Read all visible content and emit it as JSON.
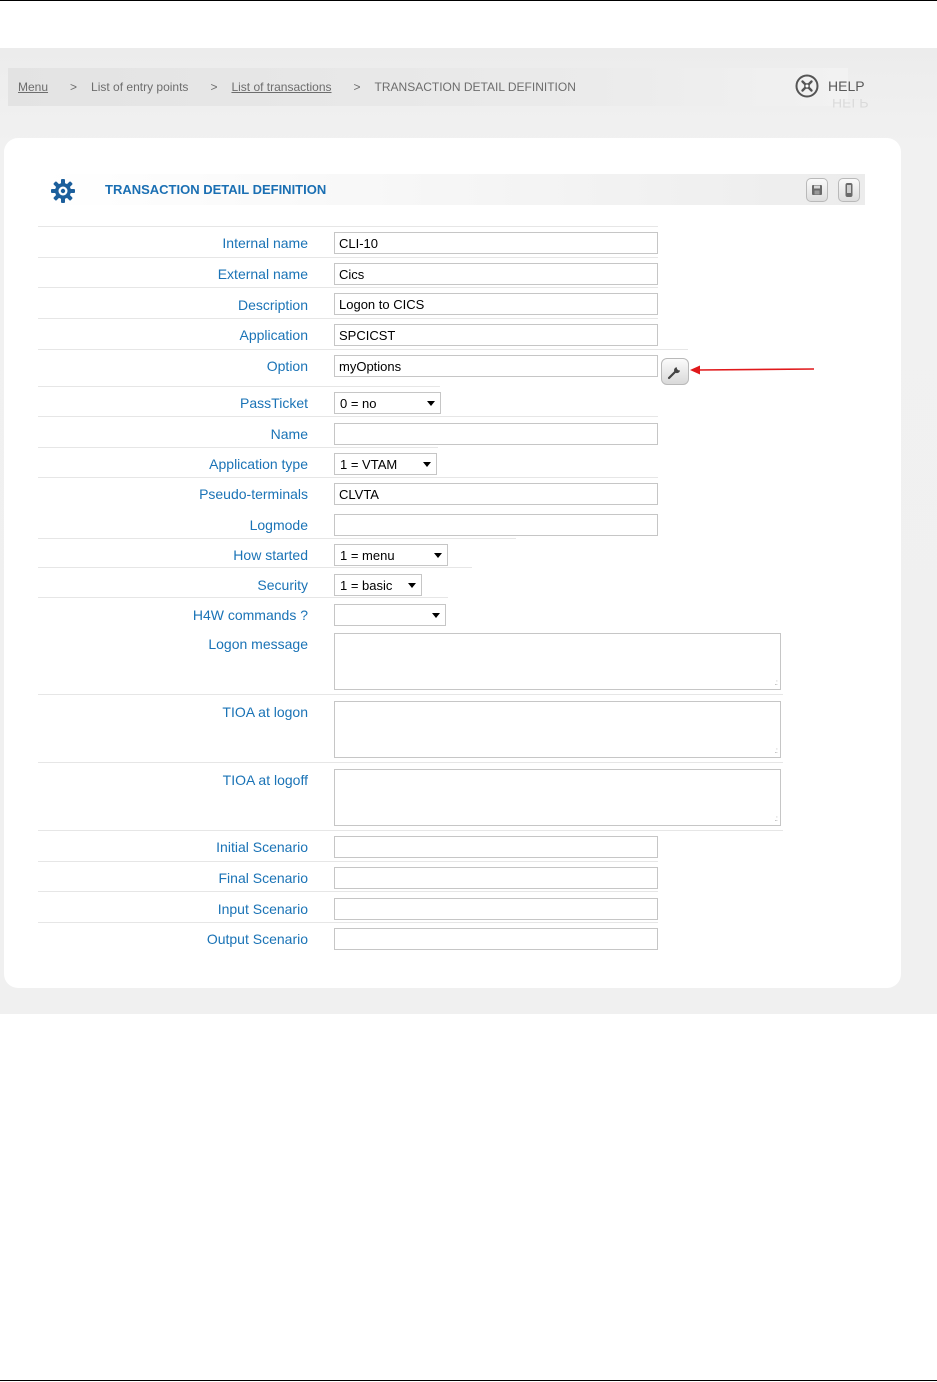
{
  "breadcrumb": {
    "menu": "Menu",
    "sep": ">",
    "entry_points": "List of entry points",
    "transactions": "List of transactions",
    "current": "TRANSACTION DETAIL DEFINITION"
  },
  "help": {
    "label": "HELP"
  },
  "form": {
    "title": "TRANSACTION DETAIL DEFINITION",
    "internal_name": {
      "label": "Internal name",
      "value": "CLI-10"
    },
    "external_name": {
      "label": "External name",
      "value": "Cics"
    },
    "description": {
      "label": "Description",
      "value": "Logon to CICS"
    },
    "application": {
      "label": "Application",
      "value": "SPCICST"
    },
    "option": {
      "label": "Option",
      "value": "myOptions"
    },
    "passticket": {
      "label": "PassTicket",
      "value": "0 = no"
    },
    "name": {
      "label": "Name",
      "value": ""
    },
    "application_type": {
      "label": "Application type",
      "value": "1 = VTAM"
    },
    "pseudo_terminals": {
      "label": "Pseudo-terminals",
      "value": "CLVTA"
    },
    "logmode": {
      "label": "Logmode",
      "value": ""
    },
    "how_started": {
      "label": "How started",
      "value": "1 = menu"
    },
    "security": {
      "label": "Security",
      "value": "1 = basic"
    },
    "h4w_commands": {
      "label": "H4W commands ?",
      "value": ""
    },
    "logon_message": {
      "label": "Logon message",
      "value": ""
    },
    "tioa_logon": {
      "label": "TIOA at logon",
      "value": ""
    },
    "tioa_logoff": {
      "label": "TIOA at logoff",
      "value": ""
    },
    "initial_scenario": {
      "label": "Initial Scenario",
      "value": ""
    },
    "final_scenario": {
      "label": "Final Scenario",
      "value": ""
    },
    "input_scenario": {
      "label": "Input Scenario",
      "value": ""
    },
    "output_scenario": {
      "label": "Output Scenario",
      "value": ""
    }
  },
  "colors": {
    "label_blue": "#1a73b6",
    "title_blue": "#1a6fb3",
    "arrow_red": "#e0191b"
  },
  "icons": [
    "help-icon",
    "gear-icon",
    "save-icon",
    "phone-icon",
    "wrench-icon",
    "arrow-annotation"
  ]
}
